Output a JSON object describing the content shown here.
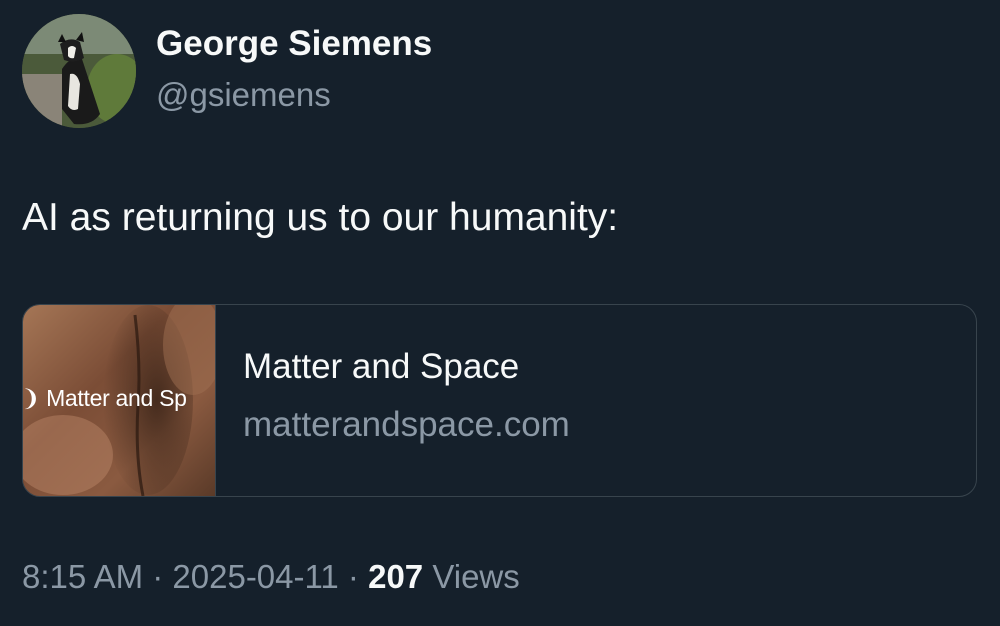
{
  "author": {
    "name": "George Siemens",
    "handle": "@gsiemens"
  },
  "tweet": {
    "text": "AI as returning us to our humanity:"
  },
  "link_card": {
    "thumbnail_text": "Matter and Sp",
    "title": "Matter and Space",
    "domain": "matterandspace.com"
  },
  "meta": {
    "time": "8:15 AM",
    "separator_1": " · ",
    "date": "2025-04-11",
    "separator_2": " · ",
    "views_count": "207",
    "views_label": " Views"
  },
  "colors": {
    "background": "#15202b",
    "primary_text": "#f7f9f9",
    "secondary_text": "#8b98a5",
    "border": "#38444d"
  },
  "icons": {
    "avatar": "dog-photo-avatar",
    "thumbnail": "skin-closeup-image"
  }
}
